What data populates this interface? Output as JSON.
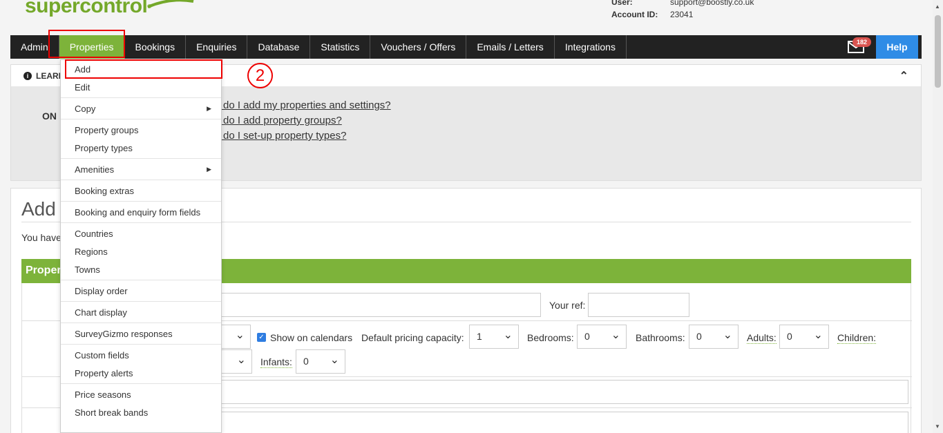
{
  "brand": {
    "logo_text": "supercontrol",
    "reg_mark": "®"
  },
  "account": {
    "user_label": "User:",
    "user_value": "support@boostly.co.uk",
    "account_label": "Account ID:",
    "account_value": "23041"
  },
  "nav": {
    "items": [
      "Admin",
      "Properties",
      "Bookings",
      "Enquiries",
      "Database",
      "Statistics",
      "Vouchers / Offers",
      "Emails / Letters",
      "Integrations"
    ],
    "active": "Properties",
    "mail_count": "182",
    "help_label": "Help"
  },
  "learn": {
    "header": "LEARN",
    "on_label": "ON",
    "links": [
      "w do I add my properties and settings?",
      "w do I add property groups?",
      "w do I set-up property types?"
    ]
  },
  "main": {
    "title": "Add",
    "intro": "You have",
    "panel_title": "Proper",
    "your_ref_label": "Your ref:",
    "show_on_calendars": "Show on calendars",
    "default_pricing_label": "Default pricing capacity:",
    "default_pricing_value": "1",
    "bedrooms_label": "Bedrooms:",
    "bedrooms_value": "0",
    "bathrooms_label": "Bathrooms:",
    "bathrooms_value": "0",
    "adults_label": "Adults:",
    "adults_value": "0",
    "children_label": "Children:",
    "infants_label": "Infants:",
    "infants_value": "0"
  },
  "dropdown": {
    "items": [
      {
        "label": "Add"
      },
      {
        "label": "Edit"
      },
      {
        "sep": true
      },
      {
        "label": "Copy",
        "sub": true
      },
      {
        "sep": true
      },
      {
        "label": "Property groups"
      },
      {
        "label": "Property types"
      },
      {
        "sep": true
      },
      {
        "label": "Amenities",
        "sub": true
      },
      {
        "sep": true
      },
      {
        "label": "Booking extras"
      },
      {
        "sep": true
      },
      {
        "label": "Booking and enquiry form fields"
      },
      {
        "sep": true
      },
      {
        "label": "Countries"
      },
      {
        "label": "Regions"
      },
      {
        "label": "Towns"
      },
      {
        "sep": true
      },
      {
        "label": "Display order"
      },
      {
        "sep": true
      },
      {
        "label": "Chart display"
      },
      {
        "sep": true
      },
      {
        "label": "SurveyGizmo responses"
      },
      {
        "sep": true
      },
      {
        "label": "Custom fields"
      },
      {
        "label": "Property alerts"
      },
      {
        "sep": true
      },
      {
        "label": "Price seasons"
      },
      {
        "label": "Short break bands"
      }
    ]
  },
  "annotation": {
    "step_number": "2",
    "color": "#e00000"
  },
  "colors": {
    "brand_green": "#7db33a",
    "nav_bg": "#222222",
    "help_blue": "#2f8ce6",
    "badge_red": "#d9534f"
  }
}
